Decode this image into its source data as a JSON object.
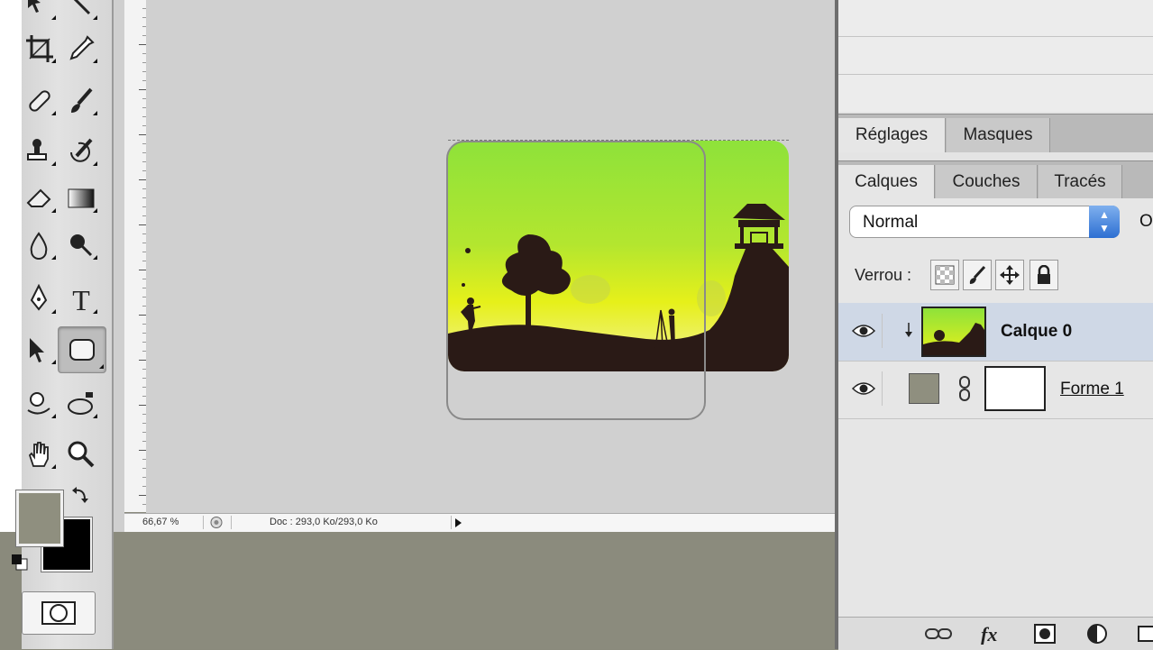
{
  "panels": {
    "adjust_tabs": [
      {
        "label": "Réglages",
        "active": true
      },
      {
        "label": "Masques",
        "active": false
      }
    ],
    "layer_tabs": [
      {
        "label": "Calques",
        "active": true
      },
      {
        "label": "Couches",
        "active": false
      },
      {
        "label": "Tracés",
        "active": false
      }
    ],
    "blend_mode": "Normal",
    "opacity_label": "O",
    "lock_label": "Verrou :",
    "layers": [
      {
        "name": "Calque 0",
        "selected": true,
        "visible": true,
        "clipped": true
      },
      {
        "name": "Forme 1",
        "selected": false,
        "visible": true,
        "color": "#8f8f7f"
      }
    ]
  },
  "status": {
    "zoom": "66,67 %",
    "doc_info": "Doc : 293,0 Ko/293,0 Ko"
  },
  "toolbox": {
    "foreground_color": "#8f8f7f",
    "background_color": "#000000",
    "tools": [
      "move-tool",
      "lasso-tool",
      "crop-tool",
      "eyedropper-tool",
      "healing-brush-tool",
      "brush-tool",
      "clone-stamp-tool",
      "history-brush-tool",
      "eraser-tool",
      "gradient-tool",
      "blur-tool",
      "dodge-tool",
      "pen-tool",
      "type-tool",
      "path-selection-tool",
      "rounded-rectangle-tool",
      "3d-rotate-tool",
      "3d-orbit-tool",
      "hand-tool",
      "zoom-tool"
    ],
    "active_tool": "rounded-rectangle-tool"
  },
  "colors": {
    "sky_top": "#8ee23a",
    "sky_bottom": "#f3f2a0",
    "silhouette": "#2a1a16",
    "accent_blue": "#2d6fd2"
  }
}
